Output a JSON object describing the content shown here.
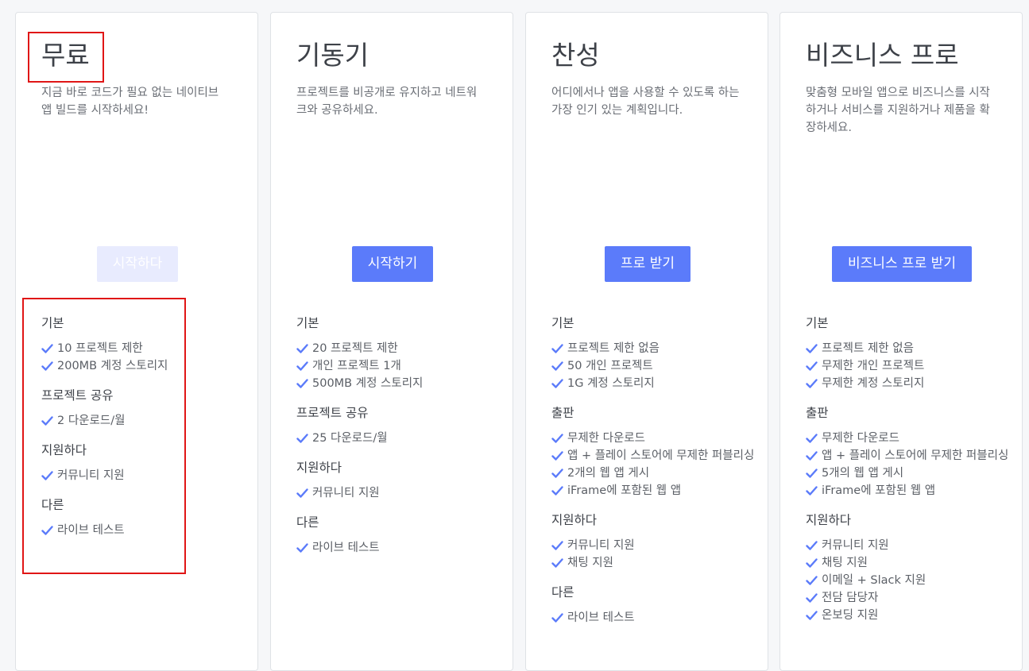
{
  "accent_color": "#5b7bfa",
  "check_icon": "check-icon",
  "plans": [
    {
      "title": "무료",
      "description": "지금 바로 코드가 필요 없는 네이티브 앱 빌드를 시작하세요!",
      "cta": "시작하다",
      "cta_disabled": true,
      "sections": [
        {
          "title": "기본",
          "items": [
            "10 프로젝트 제한",
            "200MB 계정 스토리지"
          ]
        },
        {
          "title": "프로젝트 공유",
          "items": [
            "2 다운로드/월"
          ]
        },
        {
          "title": "지원하다",
          "items": [
            "커뮤니티 지원"
          ]
        },
        {
          "title": "다른",
          "items": [
            "라이브 테스트"
          ]
        }
      ]
    },
    {
      "title": "기동기",
      "description": "프로젝트를 비공개로 유지하고 네트워크와 공유하세요.",
      "cta": "시작하기",
      "cta_disabled": false,
      "sections": [
        {
          "title": "기본",
          "items": [
            "20 프로젝트 제한",
            "개인 프로젝트 1개",
            "500MB 계정 스토리지"
          ]
        },
        {
          "title": "프로젝트 공유",
          "items": [
            "25 다운로드/월"
          ]
        },
        {
          "title": "지원하다",
          "items": [
            "커뮤니티 지원"
          ]
        },
        {
          "title": "다른",
          "items": [
            "라이브 테스트"
          ]
        }
      ]
    },
    {
      "title": "찬성",
      "description": "어디에서나 앱을 사용할 수 있도록 하는 가장 인기 있는 계획입니다.",
      "cta": "프로 받기",
      "cta_disabled": false,
      "sections": [
        {
          "title": "기본",
          "items": [
            "프로젝트 제한 없음",
            "50 개인 프로젝트",
            "1G 계정 스토리지"
          ]
        },
        {
          "title": "출판",
          "items": [
            "무제한 다운로드",
            "앱 + 플레이 스토어에 무제한 퍼블리싱",
            "2개의 웹 앱 게시",
            "iFrame에 포함된 웹 앱"
          ]
        },
        {
          "title": "지원하다",
          "items": [
            "커뮤니티 지원",
            "채팅 지원"
          ]
        },
        {
          "title": "다른",
          "items": [
            "라이브 테스트"
          ]
        }
      ]
    },
    {
      "title": "비즈니스 프로",
      "description": "맞춤형 모바일 앱으로 비즈니스를 시작하거나 서비스를 지원하거나 제품을 확장하세요.",
      "cta": "비즈니스 프로 받기",
      "cta_disabled": false,
      "sections": [
        {
          "title": "기본",
          "items": [
            "프로젝트 제한 없음",
            "무제한 개인 프로젝트",
            "무제한 계정 스토리지"
          ]
        },
        {
          "title": "출판",
          "items": [
            "무제한 다운로드",
            "앱 + 플레이 스토어에 무제한 퍼블리싱",
            "5개의 웹 앱 게시",
            "iFrame에 포함된 웹 앱"
          ]
        },
        {
          "title": "지원하다",
          "items": [
            "커뮤니티 지원",
            "채팅 지원",
            "이메일 + Slack 지원",
            "전담 담당자",
            "온보딩 지원"
          ]
        }
      ]
    }
  ]
}
